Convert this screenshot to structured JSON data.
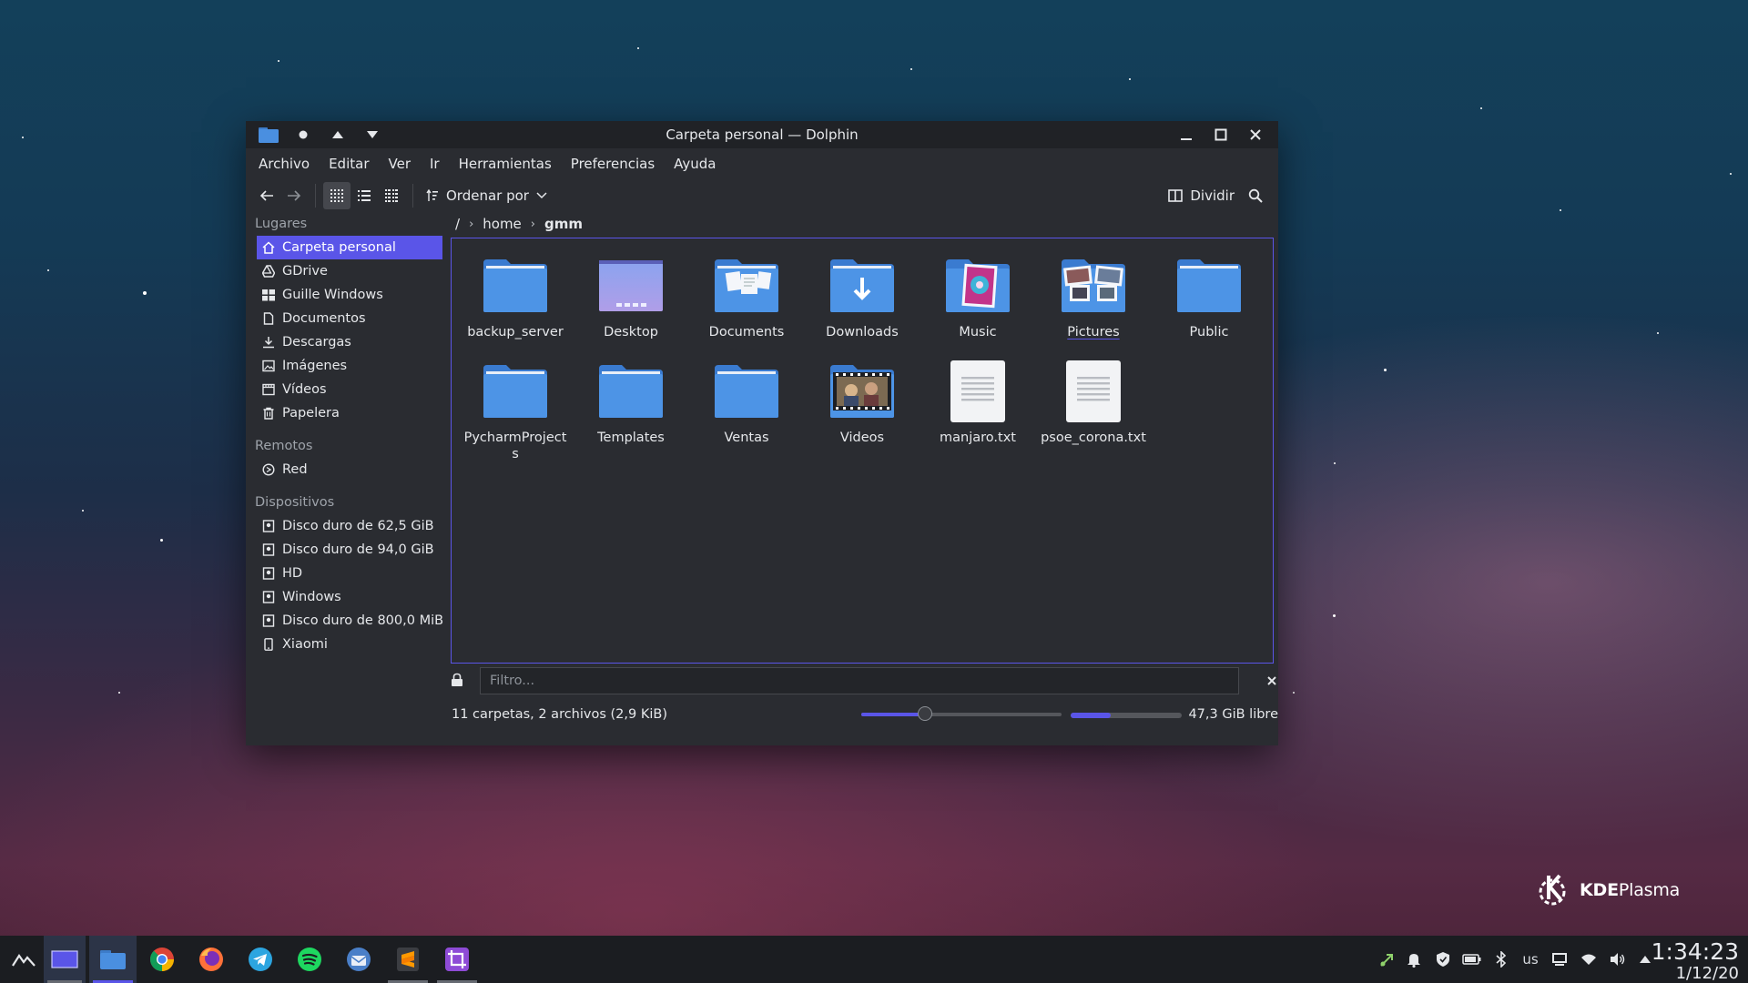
{
  "window": {
    "title": "Carpeta personal — Dolphin"
  },
  "menu": [
    "Archivo",
    "Editar",
    "Ver",
    "Ir",
    "Herramientas",
    "Preferencias",
    "Ayuda"
  ],
  "toolbar": {
    "sort_label": "Ordenar por",
    "split_label": "Dividir"
  },
  "sidebar": {
    "places_title": "Lugares",
    "places": [
      {
        "label": "Carpeta personal",
        "icon": "home-icon"
      },
      {
        "label": "GDrive",
        "icon": "gdrive-icon"
      },
      {
        "label": "Guille Windows",
        "icon": "windows-icon"
      },
      {
        "label": "Documentos",
        "icon": "document-icon"
      },
      {
        "label": "Descargas",
        "icon": "download-icon"
      },
      {
        "label": "Imágenes",
        "icon": "image-icon"
      },
      {
        "label": "Vídeos",
        "icon": "video-icon"
      },
      {
        "label": "Papelera",
        "icon": "trash-icon"
      }
    ],
    "remote_title": "Remotos",
    "remote": [
      {
        "label": "Red",
        "icon": "network-icon"
      }
    ],
    "devices_title": "Dispositivos",
    "devices": [
      {
        "label": "Disco duro de 62,5 GiB",
        "icon": "drive-icon"
      },
      {
        "label": "Disco duro de 94,0 GiB",
        "icon": "drive-icon"
      },
      {
        "label": "HD",
        "icon": "drive-icon"
      },
      {
        "label": "Windows",
        "icon": "drive-icon"
      },
      {
        "label": "Disco duro de 800,0 MiB",
        "icon": "drive-icon"
      },
      {
        "label": "Xiaomi",
        "icon": "phone-icon"
      }
    ]
  },
  "breadcrumb": [
    "/",
    "home",
    "gmm"
  ],
  "files": [
    {
      "name": "backup_server",
      "type": "folder"
    },
    {
      "name": "Desktop",
      "type": "desktop-folder"
    },
    {
      "name": "Documents",
      "type": "documents-folder"
    },
    {
      "name": "Downloads",
      "type": "downloads-folder"
    },
    {
      "name": "Music",
      "type": "music-folder"
    },
    {
      "name": "Pictures",
      "type": "pictures-folder"
    },
    {
      "name": "Public",
      "type": "folder"
    },
    {
      "name": "PycharmProjects",
      "type": "folder"
    },
    {
      "name": "Templates",
      "type": "folder"
    },
    {
      "name": "Ventas",
      "type": "folder"
    },
    {
      "name": "Videos",
      "type": "videos-folder"
    },
    {
      "name": "manjaro.txt",
      "type": "text-file"
    },
    {
      "name": "psoe_corona.txt",
      "type": "text-file"
    }
  ],
  "filter": {
    "placeholder": "Filtro..."
  },
  "status": {
    "summary": "11 carpetas, 2 archivos (2,9 KiB)",
    "zoom_fraction": 0.32,
    "used_fraction": 0.36,
    "free_space": "47,3 GiB libre"
  },
  "branding": {
    "kde": "KDE",
    "plasma": "Plasma"
  },
  "taskbar": {
    "apps": [
      "app-launcher-icon",
      "pager-icon",
      "dolphin-icon",
      "chrome-icon",
      "firefox-icon",
      "telegram-icon",
      "spotify-icon",
      "thunderbird-icon",
      "sublime-text-icon",
      "screenshot-tool-icon"
    ],
    "keyboard_layout": "us",
    "time": "1:34:23",
    "date": "1/12/20"
  },
  "colors": {
    "accent": "#5a55e8",
    "folder": "#4a8fe0"
  }
}
